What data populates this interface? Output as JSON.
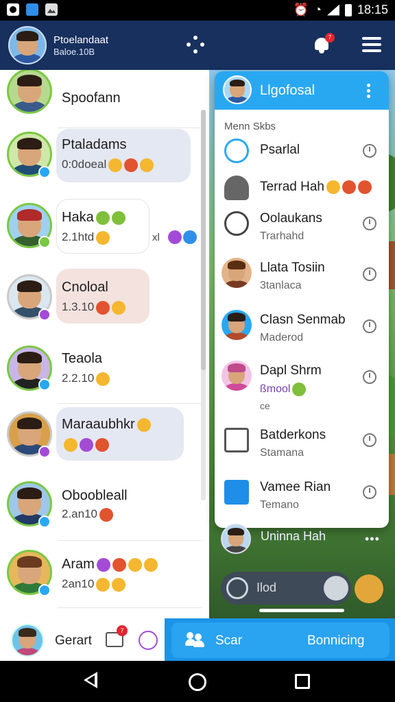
{
  "status_bar": {
    "time": "18:15"
  },
  "header": {
    "title": "Ptoelandaat",
    "subtitle": "Baloe.10B",
    "notification_count": "7"
  },
  "chats": [
    {
      "name": "Spoofann",
      "preview": "",
      "status_color": "#7ac843"
    },
    {
      "name": "Ptaladams",
      "preview": "0:0doeal",
      "status_color": "#29a8f2"
    },
    {
      "name": "Haka",
      "preview": "2.1htd",
      "status_color": "#7ac843"
    },
    {
      "name": "Cnoloal",
      "preview": "1.3.10",
      "status_color": "#a34bd6"
    },
    {
      "name": "Teaola",
      "preview": "2.2.10",
      "status_color": "#29a8f2"
    },
    {
      "name": "Maraaubhkr",
      "preview": "",
      "status_color": "#a34bd6"
    },
    {
      "name": "Oboobleall",
      "preview": "2.an10",
      "status_color": "#29a8f2"
    },
    {
      "name": "Aram",
      "preview": "2an10",
      "status_color": "#29a8f2"
    }
  ],
  "haka_extra": "xl",
  "dropdown": {
    "title": "Llgofosal",
    "section_label": "Menn Skbs",
    "items": [
      {
        "line1": "Psarlal",
        "line2": "",
        "icon": "face-icon"
      },
      {
        "line1": "Terrad Hah",
        "line2": "",
        "icon": "person-icon"
      },
      {
        "line1": "Oolaukans",
        "line2": "Trarhahd",
        "icon": "refresh-icon"
      },
      {
        "line1": "Llata Tosiin",
        "line2": "3tanlaca",
        "icon": "avatar-icon"
      },
      {
        "line1": "Clasn Senmab",
        "line2": "Maderod",
        "icon": "avatar-icon"
      },
      {
        "line1": "Dapl Shrm",
        "line2": "ßmool",
        "line3": "ce",
        "icon": "avatar-icon"
      },
      {
        "line1": "Batderkons",
        "line2": "Stamana",
        "icon": "grid-icon"
      },
      {
        "line1": "Vamee Rian",
        "line2": "Temano",
        "icon": "edit-icon"
      }
    ]
  },
  "peek": {
    "name": "Uninna Hah",
    "more": "•••"
  },
  "composer": {
    "placeholder": "Ilod"
  },
  "bottom": {
    "profile_label": "Gerart",
    "message_badge": "7",
    "scan_label": "Scar",
    "right_label": "Bonnicing"
  }
}
